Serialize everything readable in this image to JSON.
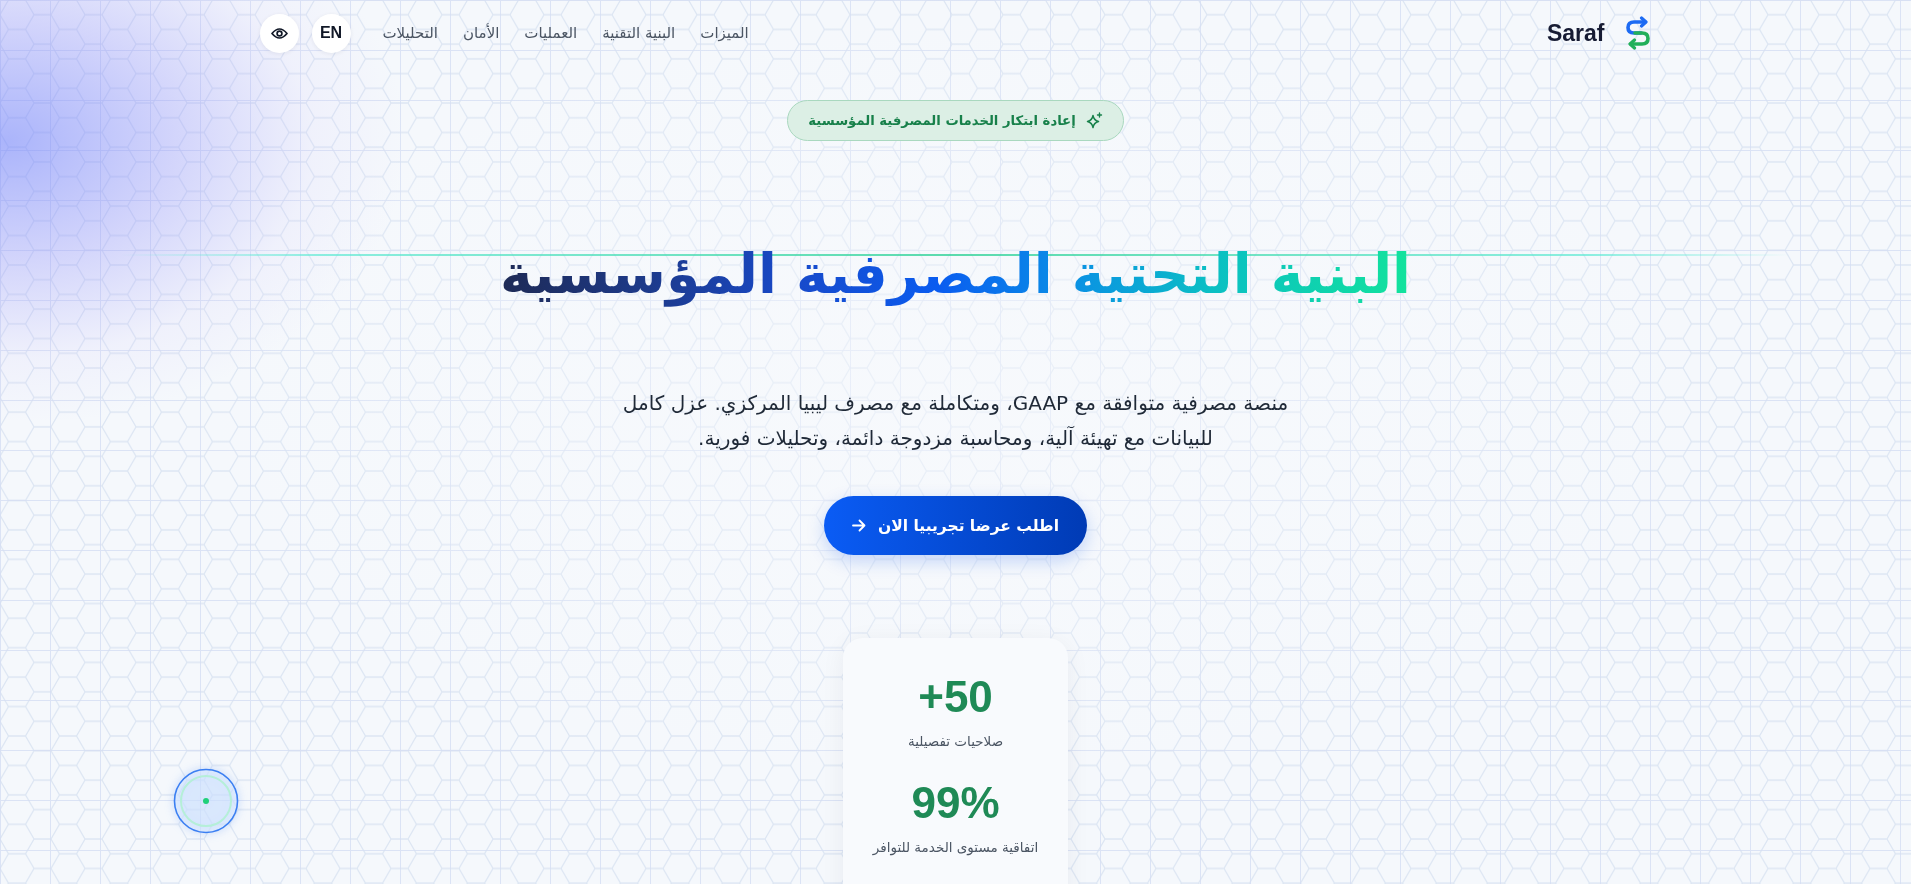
{
  "header": {
    "logo": {
      "text": "Saraf"
    },
    "nav": [
      {
        "label": "الميزات"
      },
      {
        "label": "البنية التقنية"
      },
      {
        "label": "العمليات"
      },
      {
        "label": "الأمان"
      },
      {
        "label": "التحليلات"
      }
    ],
    "language_button": "EN"
  },
  "hero": {
    "badge": "إعادة ابتكار الخدمات المصرفية المؤسسية",
    "title": "البنية التحتية المصرفية المؤسسية",
    "description": "منصة مصرفية متوافقة مع GAAP، ومتكاملة مع مصرف ليبيا المركزي. عزل كامل للبيانات مع تهيئة آلية، ومحاسبة مزدوجة دائمة، وتحليلات فورية.",
    "cta": "اطلب عرضا تجريبيا الان"
  },
  "stats": [
    {
      "value": "+50",
      "label": "صلاحيات تفصيلية"
    },
    {
      "value": "99%",
      "label": "اتفاقية مستوى الخدمة للتوافر"
    }
  ]
}
